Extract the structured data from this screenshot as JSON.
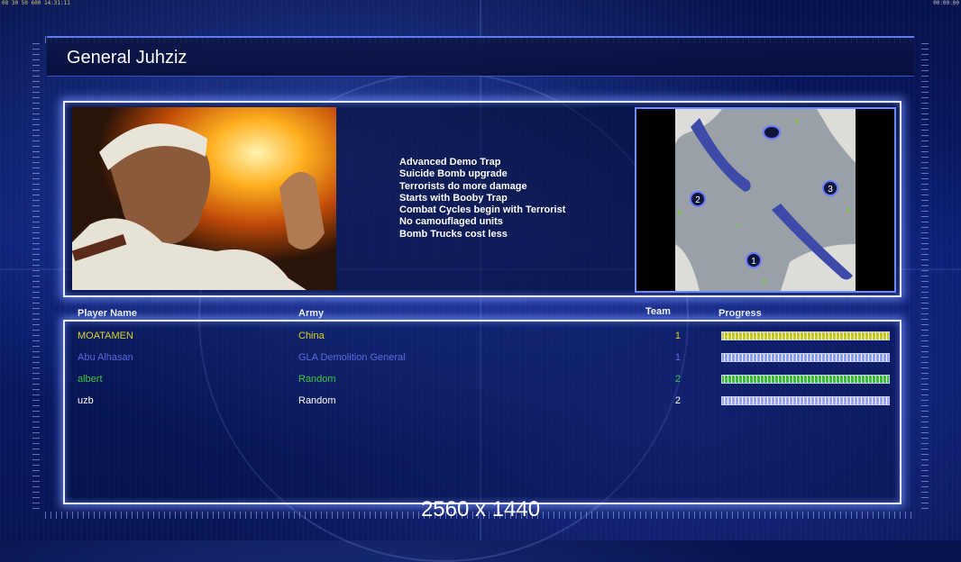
{
  "hud": {
    "left_text": "08 30 50 600 14:31:11",
    "right_text": "00:00:00"
  },
  "title": "General Juhziz",
  "description": [
    "Advanced Demo Trap",
    "Suicide Bomb upgrade",
    "Terrorists do more damage",
    "Starts with Booby Trap",
    "Combat Cycles begin with Terrorist",
    "No camouflaged units",
    "Bomb Trucks cost less"
  ],
  "map": {
    "start_positions": [
      "1",
      "2",
      "3"
    ]
  },
  "table": {
    "headers": {
      "player": "Player Name",
      "army": "Army",
      "team": "Team",
      "progress": "Progress"
    },
    "rows": [
      {
        "name": "MOATAMEN",
        "army": "China",
        "team": "1",
        "color": "#d6d62a",
        "bar_color": "#c8c818",
        "progress": 1.0
      },
      {
        "name": "Abu Alhasan",
        "army": "GLA Demolition General",
        "team": "1",
        "color": "#5a6adc",
        "bar_color": "#8c9cff",
        "progress": 1.0
      },
      {
        "name": "albert",
        "army": "Random",
        "team": "2",
        "color": "#3cc83c",
        "bar_color": "#36c236",
        "progress": 1.0
      },
      {
        "name": "uzb",
        "army": "Random",
        "team": "2",
        "color": "#ffffff",
        "bar_color": "#9aa6ff",
        "progress": 1.0
      }
    ]
  },
  "resolution_label": "2560 x 1440"
}
